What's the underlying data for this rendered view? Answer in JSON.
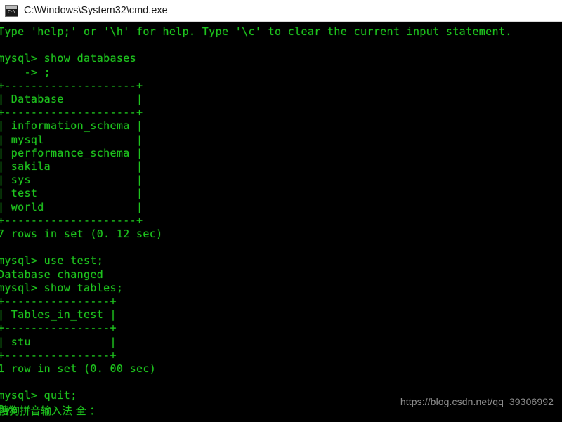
{
  "window": {
    "titlebar": {
      "icon": "cmd-window-icon",
      "icon_glyph": "C:\\",
      "title": "C:\\Windows\\System32\\cmd.exe"
    }
  },
  "console": {
    "prompt": "mysql>",
    "continuation_prompt": "->",
    "lines": [
      "Type 'help;' or '\\h' for help. Type '\\c' to clear the current input statement.",
      "",
      "mysql> show databases",
      "    -> ;",
      "+--------------------+",
      "| Database           |",
      "+--------------------+",
      "| information_schema |",
      "| mysql              |",
      "| performance_schema |",
      "| sakila             |",
      "| sys                |",
      "| test               |",
      "| world              |",
      "+--------------------+",
      "7 rows in set (0. 12 sec)",
      "",
      "mysql> use test;",
      "Database changed",
      "mysql> show tables;",
      "+----------------+",
      "| Tables_in_test |",
      "+----------------+",
      "| stu            |",
      "+----------------+",
      "1 row in set (0. 00 sec)",
      "",
      "mysql> quit;",
      "Bye"
    ],
    "commands": [
      "show databases",
      ";",
      "use test;",
      "show tables;",
      "quit;"
    ],
    "results": {
      "databases": {
        "column_header": "Database",
        "rows": [
          "information_schema",
          "mysql",
          "performance_schema",
          "sakila",
          "sys",
          "test",
          "world"
        ],
        "status": "7 rows in set (0. 12 sec)",
        "row_count": 7,
        "elapsed_seconds": "0. 12"
      },
      "tables": {
        "column_header": "Tables_in_test",
        "rows": [
          "stu"
        ],
        "status": "1 row in set (0. 00 sec)",
        "row_count": 1,
        "elapsed_seconds": "0. 00"
      },
      "use_database": {
        "message": "Database changed",
        "database": "test"
      },
      "quit": {
        "message": "Bye"
      }
    },
    "colors": {
      "background": "#000000",
      "foreground": "#1ec41e"
    }
  },
  "ime_status": {
    "text": "搜狗拼音输入法 全 ："
  },
  "watermark": {
    "text": "https://blog.csdn.net/qq_39306992",
    "color": "#8e8e8e"
  }
}
